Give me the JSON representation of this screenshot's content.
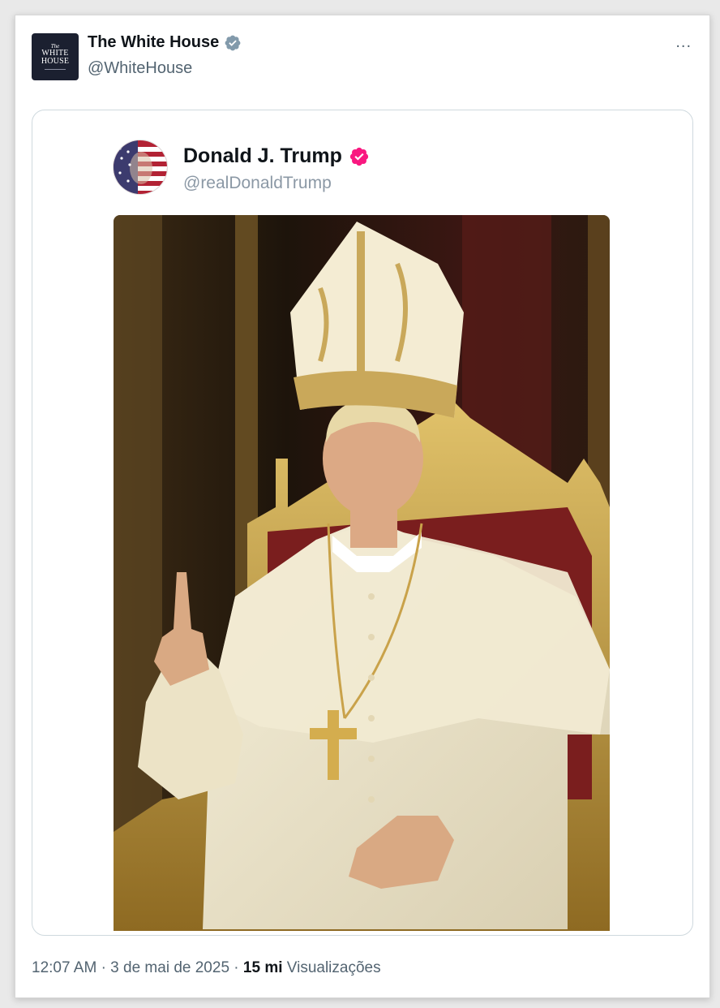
{
  "author": {
    "name": "The White House",
    "handle": "@WhiteHouse",
    "avatar_lines": [
      "The",
      "WHITE",
      "HOUSE"
    ],
    "verified_color": "#829aab"
  },
  "more_icon": "...",
  "embedded": {
    "name": "Donald J. Trump",
    "handle": "@realDonaldTrump",
    "verified_color": "#f91880"
  },
  "footer": {
    "time": "12:07 AM",
    "separator": "·",
    "date": "3 de mai de 2025",
    "views_count": "15 mi",
    "views_label": "Visualizações"
  }
}
